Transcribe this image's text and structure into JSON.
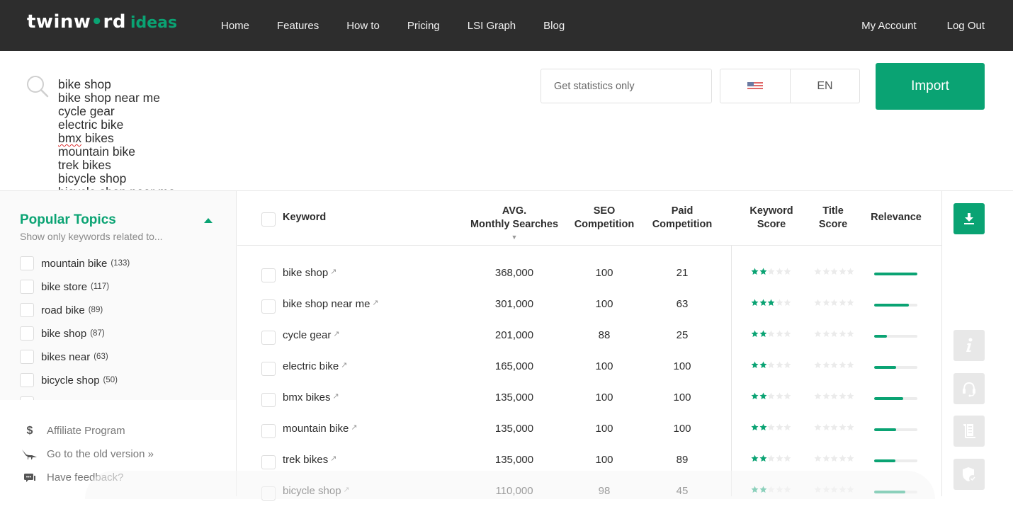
{
  "header": {
    "logo_main": "twinw",
    "logo_dot": "•",
    "logo_tail": "rd",
    "logo_sub": "ideas",
    "nav": [
      "Home",
      "Features",
      "How to",
      "Pricing",
      "LSI Graph",
      "Blog"
    ],
    "account": "My Account",
    "logout": "Log Out"
  },
  "search": {
    "keywords": [
      "bike shop",
      "bike shop near me",
      "cycle gear",
      "electric bike",
      "bmx bikes",
      "mountain bike",
      "trek bikes",
      "bicycle shop",
      "bicycle shop near me"
    ],
    "stats_placeholder": "Get statistics only",
    "country_flag": "us-flag",
    "language": "EN",
    "import_label": "Import"
  },
  "sidebar": {
    "title": "Popular Topics",
    "subtitle": "Show only keywords related to...",
    "topics": [
      {
        "label": "mountain bike",
        "count": "(133)"
      },
      {
        "label": "bike store",
        "count": "(117)"
      },
      {
        "label": "road bike",
        "count": "(89)"
      },
      {
        "label": "bike shop",
        "count": "(87)"
      },
      {
        "label": "bikes near",
        "count": "(63)"
      },
      {
        "label": "bicycle shop",
        "count": "(50)"
      }
    ],
    "links": [
      {
        "icon": "dollar-icon",
        "glyph": "$",
        "label": "Affiliate Program"
      },
      {
        "icon": "dinosaur-icon",
        "glyph": "",
        "label": "Go to the old version »"
      },
      {
        "icon": "feedback-icon",
        "glyph": "",
        "label": "Have feedback?"
      }
    ]
  },
  "table": {
    "headers": {
      "keyword": "Keyword",
      "avg_line1": "AVG.",
      "avg_line2": "Monthly Searches",
      "avg_sort": "▼",
      "seo_line1": "SEO",
      "seo_line2": "Competition",
      "paid_line1": "Paid",
      "paid_line2": "Competition",
      "ks_line1": "Keyword",
      "ks_line2": "Score",
      "ts_line1": "Title",
      "ts_line2": "Score",
      "relevance": "Relevance"
    },
    "rows": [
      {
        "keyword": "bike shop",
        "avg": "368,000",
        "seo": "100",
        "paid": "21",
        "keyword_score": 2,
        "title_score": 0,
        "relevance": 1.0
      },
      {
        "keyword": "bike shop near me",
        "avg": "301,000",
        "seo": "100",
        "paid": "63",
        "keyword_score": 3,
        "title_score": 0,
        "relevance": 0.8
      },
      {
        "keyword": "cycle gear",
        "avg": "201,000",
        "seo": "88",
        "paid": "25",
        "keyword_score": 2,
        "title_score": 0,
        "relevance": 0.29
      },
      {
        "keyword": "electric bike",
        "avg": "165,000",
        "seo": "100",
        "paid": "100",
        "keyword_score": 2,
        "title_score": 0,
        "relevance": 0.51
      },
      {
        "keyword": "bmx bikes",
        "avg": "135,000",
        "seo": "100",
        "paid": "100",
        "keyword_score": 2,
        "title_score": 0,
        "relevance": 0.67
      },
      {
        "keyword": "mountain bike",
        "avg": "135,000",
        "seo": "100",
        "paid": "100",
        "keyword_score": 2,
        "title_score": 0,
        "relevance": 0.51
      },
      {
        "keyword": "trek bikes",
        "avg": "135,000",
        "seo": "100",
        "paid": "89",
        "keyword_score": 2,
        "title_score": 0,
        "relevance": 0.49
      },
      {
        "keyword": "bicycle shop",
        "avg": "110,000",
        "seo": "98",
        "paid": "45",
        "keyword_score": 2,
        "title_score": 0,
        "relevance": 0.72
      }
    ],
    "external_link_glyph": "↗"
  },
  "rail": {
    "buttons": [
      "download-icon",
      "info-icon",
      "headset-icon",
      "document-icon",
      "shield-icon"
    ]
  },
  "colors": {
    "accent": "#0aa373",
    "header_bg": "#2d2d2d",
    "star_empty": "#ebebeb",
    "bar_track": "#ececec"
  }
}
